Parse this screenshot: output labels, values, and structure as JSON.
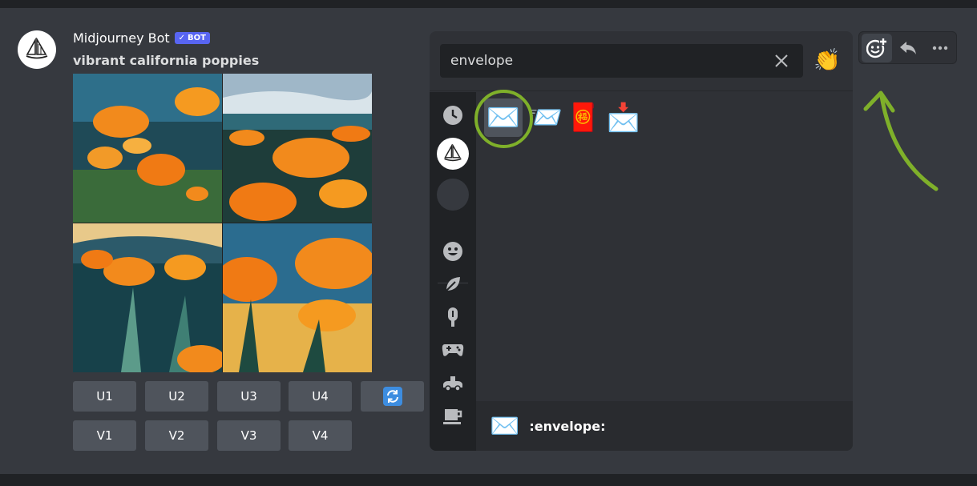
{
  "message": {
    "author": "Midjourney Bot",
    "bot_tag": "BOT",
    "prompt": "vibrant california poppies"
  },
  "buttons": {
    "upscale": [
      "U1",
      "U2",
      "U3",
      "U4"
    ],
    "variation": [
      "V1",
      "V2",
      "V3",
      "V4"
    ],
    "reroll_icon": "refresh-icon"
  },
  "emoji_picker": {
    "search_value": "envelope",
    "skin_tone_emoji": "👏",
    "categories": [
      "clock-icon",
      "midjourney-server-icon",
      "server-icon",
      "smiley-icon",
      "leaf-icon",
      "popsicle-icon",
      "gamepad-icon",
      "car-icon",
      "coffee-icon"
    ],
    "results": [
      "✉️",
      "📨",
      "🧧",
      "📩"
    ],
    "preview_emoji": "✉️",
    "preview_name": ":envelope:"
  },
  "toolbar": {
    "icons": [
      "add-reaction-icon",
      "reply-icon",
      "more-icon"
    ]
  },
  "colors": {
    "background": "#36393f",
    "picker": "#2f3136",
    "rail": "#202225",
    "button": "#4f545c",
    "bot_tag": "#5865f2",
    "annotation": "#7fb02a"
  }
}
